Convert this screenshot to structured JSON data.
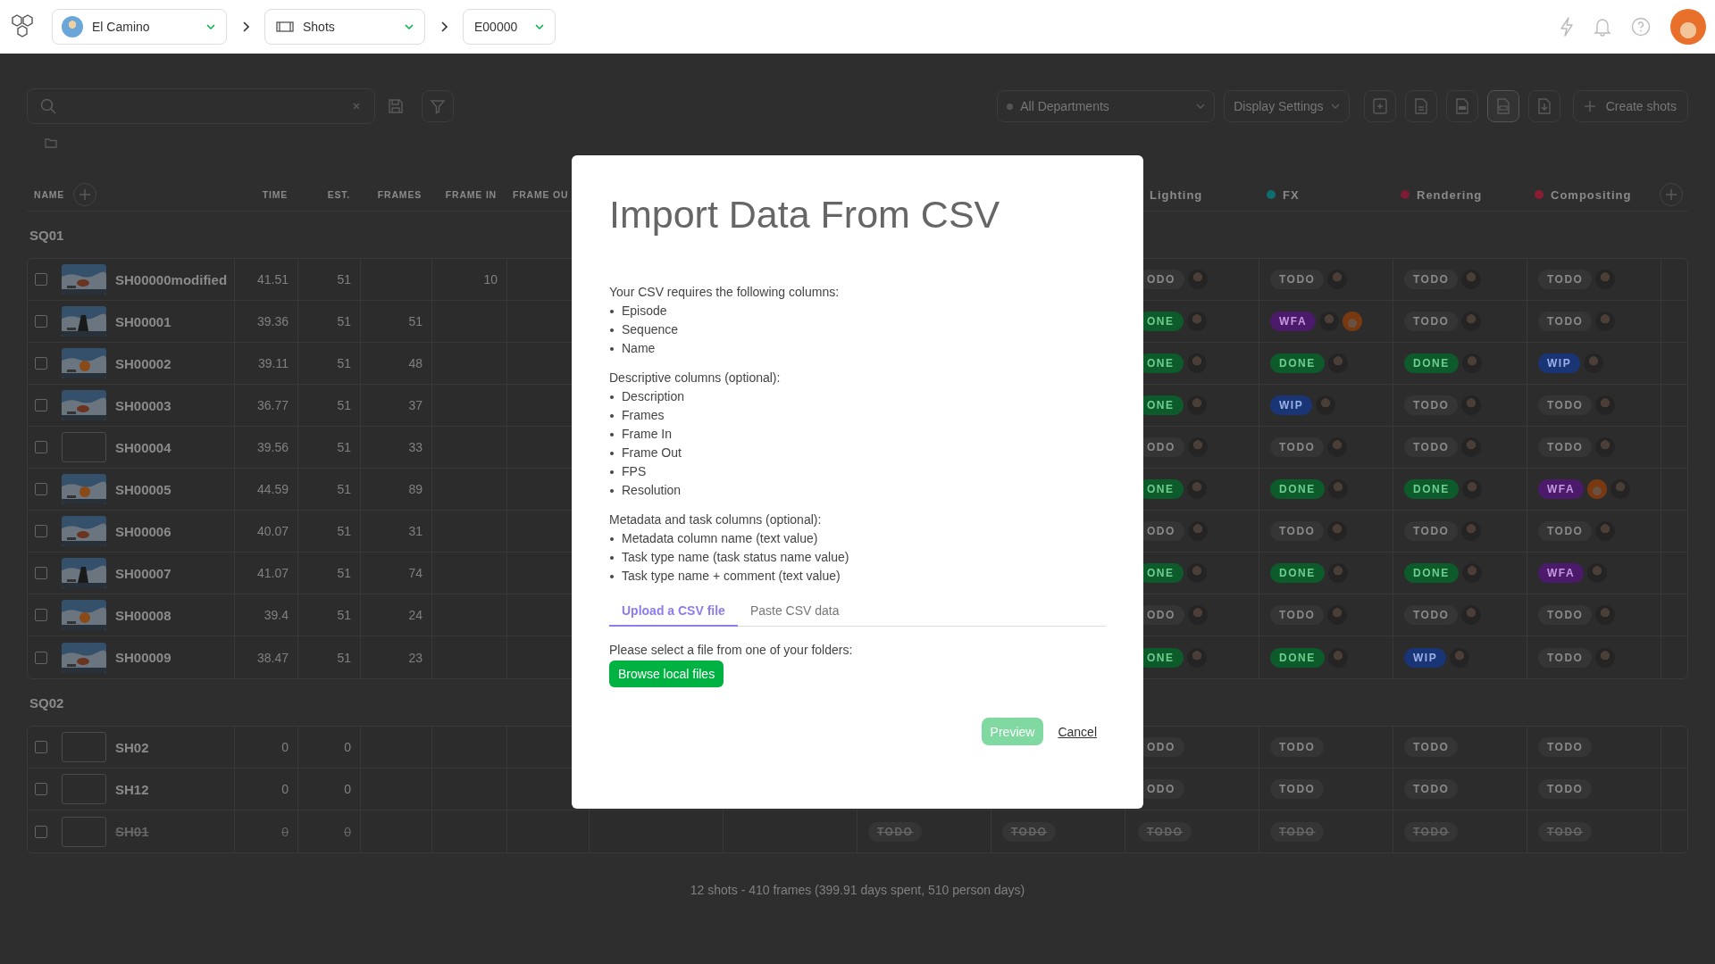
{
  "topbar": {
    "project": "El Camino",
    "section": "Shots",
    "episode": "E00000"
  },
  "toolbar": {
    "department_filter": "All Departments",
    "display_settings": "Display Settings",
    "create_button": "Create shots"
  },
  "table": {
    "columns": [
      {
        "label": "NAME"
      },
      {
        "label": "TIME"
      },
      {
        "label": "EST."
      },
      {
        "label": "FRAMES"
      },
      {
        "label": "FRAME IN"
      },
      {
        "label": "FRAME OU"
      }
    ],
    "task_columns": [
      {
        "name": "Lighting"
      },
      {
        "name": "FX",
        "color": "#0e6e6e"
      },
      {
        "name": "Rendering",
        "color": "#7c1d35"
      },
      {
        "name": "Compositing",
        "color": "#8a1c34"
      }
    ],
    "groups": [
      {
        "name": "SQ01",
        "rows": [
          {
            "name": "SH00000modified",
            "checked": false,
            "canceled": false,
            "thumbnail": true,
            "time": "41.51",
            "est": "51",
            "frame_in": "10",
            "tasks": [
              {
                "status": "ODO",
                "kind": "todo",
                "assignees": [
                  {
                    "kind": "person"
                  }
                ]
              },
              {
                "status": "TODO",
                "kind": "todo",
                "assignees": [
                  {
                    "kind": "person"
                  }
                ]
              },
              {
                "status": "TODO",
                "kind": "todo",
                "assignees": [
                  {
                    "kind": "person"
                  }
                ]
              },
              {
                "status": "TODO",
                "kind": "todo",
                "assignees": [
                  {
                    "kind": "person"
                  }
                ]
              }
            ]
          },
          {
            "name": "SH00001",
            "checked": false,
            "canceled": false,
            "thumbnail": true,
            "time": "39.36",
            "est": "51",
            "frames": "51",
            "tasks": [
              {
                "status": "ONE",
                "kind": "done",
                "assignees": [
                  {
                    "kind": "person"
                  }
                ]
              },
              {
                "status": "WFA",
                "kind": "wfa",
                "assignees": [
                  {
                    "kind": "person"
                  },
                  {
                    "kind": "fox"
                  }
                ]
              },
              {
                "status": "TODO",
                "kind": "todo",
                "assignees": [
                  {
                    "kind": "person"
                  }
                ]
              },
              {
                "status": "TODO",
                "kind": "todo",
                "assignees": [
                  {
                    "kind": "person"
                  }
                ]
              }
            ]
          },
          {
            "name": "SH00002",
            "checked": false,
            "canceled": false,
            "thumbnail": true,
            "time": "39.11",
            "est": "51",
            "frames": "48",
            "tasks": [
              {
                "status": "ONE",
                "kind": "done",
                "assignees": [
                  {
                    "kind": "person"
                  }
                ]
              },
              {
                "status": "DONE",
                "kind": "done",
                "assignees": [
                  {
                    "kind": "person"
                  }
                ]
              },
              {
                "status": "DONE",
                "kind": "done",
                "assignees": [
                  {
                    "kind": "person"
                  }
                ]
              },
              {
                "status": "WIP",
                "kind": "wip",
                "assignees": [
                  {
                    "kind": "person"
                  }
                ]
              }
            ]
          },
          {
            "name": "SH00003",
            "checked": false,
            "canceled": false,
            "thumbnail": true,
            "time": "36.77",
            "est": "51",
            "frames": "37",
            "tasks": [
              {
                "status": "ONE",
                "kind": "done",
                "assignees": [
                  {
                    "kind": "person"
                  }
                ]
              },
              {
                "status": "WIP",
                "kind": "wip",
                "assignees": [
                  {
                    "kind": "person"
                  }
                ]
              },
              {
                "status": "TODO",
                "kind": "todo",
                "assignees": [
                  {
                    "kind": "person"
                  }
                ]
              },
              {
                "status": "TODO",
                "kind": "todo",
                "assignees": [
                  {
                    "kind": "person"
                  }
                ]
              }
            ]
          },
          {
            "name": "SH00004",
            "checked": false,
            "canceled": false,
            "thumbnail": false,
            "time": "39.56",
            "est": "51",
            "frames": "33",
            "tasks": [
              {
                "status": "ODO",
                "kind": "todo",
                "assignees": [
                  {
                    "kind": "person"
                  }
                ]
              },
              {
                "status": "TODO",
                "kind": "todo",
                "assignees": [
                  {
                    "kind": "person"
                  }
                ]
              },
              {
                "status": "TODO",
                "kind": "todo",
                "assignees": [
                  {
                    "kind": "person"
                  }
                ]
              },
              {
                "status": "TODO",
                "kind": "todo",
                "assignees": [
                  {
                    "kind": "person"
                  }
                ]
              }
            ]
          },
          {
            "name": "SH00005",
            "checked": false,
            "canceled": false,
            "thumbnail": true,
            "time": "44.59",
            "est": "51",
            "frames": "89",
            "tasks": [
              {
                "status": "ONE",
                "kind": "done",
                "assignees": [
                  {
                    "kind": "person"
                  }
                ]
              },
              {
                "status": "DONE",
                "kind": "done",
                "assignees": [
                  {
                    "kind": "person"
                  }
                ]
              },
              {
                "status": "DONE",
                "kind": "done",
                "assignees": [
                  {
                    "kind": "person"
                  }
                ]
              },
              {
                "status": "WFA",
                "kind": "wfa",
                "assignees": [
                  {
                    "kind": "fox"
                  },
                  {
                    "kind": "person"
                  }
                ]
              }
            ]
          },
          {
            "name": "SH00006",
            "checked": false,
            "canceled": false,
            "thumbnail": true,
            "time": "40.07",
            "est": "51",
            "frames": "31",
            "tasks": [
              {
                "status": "ODO",
                "kind": "todo",
                "assignees": [
                  {
                    "kind": "person"
                  }
                ]
              },
              {
                "status": "TODO",
                "kind": "todo",
                "assignees": [
                  {
                    "kind": "person"
                  }
                ]
              },
              {
                "status": "TODO",
                "kind": "todo",
                "assignees": [
                  {
                    "kind": "person"
                  }
                ]
              },
              {
                "status": "TODO",
                "kind": "todo",
                "assignees": [
                  {
                    "kind": "person"
                  }
                ]
              }
            ]
          },
          {
            "name": "SH00007",
            "checked": false,
            "canceled": false,
            "thumbnail": true,
            "time": "41.07",
            "est": "51",
            "frames": "74",
            "tasks": [
              {
                "status": "ONE",
                "kind": "done",
                "assignees": [
                  {
                    "kind": "person"
                  }
                ]
              },
              {
                "status": "DONE",
                "kind": "done",
                "assignees": [
                  {
                    "kind": "person"
                  }
                ]
              },
              {
                "status": "DONE",
                "kind": "done",
                "assignees": [
                  {
                    "kind": "person"
                  }
                ]
              },
              {
                "status": "WFA",
                "kind": "wfa",
                "assignees": [
                  {
                    "kind": "person"
                  }
                ]
              }
            ]
          },
          {
            "name": "SH00008",
            "checked": false,
            "canceled": false,
            "thumbnail": true,
            "time": "39.4",
            "est": "51",
            "frames": "24",
            "tasks": [
              {
                "status": "ODO",
                "kind": "todo",
                "assignees": [
                  {
                    "kind": "person"
                  }
                ]
              },
              {
                "status": "TODO",
                "kind": "todo",
                "assignees": [
                  {
                    "kind": "person"
                  }
                ]
              },
              {
                "status": "TODO",
                "kind": "todo",
                "assignees": [
                  {
                    "kind": "person"
                  }
                ]
              },
              {
                "status": "TODO",
                "kind": "todo",
                "assignees": [
                  {
                    "kind": "person"
                  }
                ]
              }
            ]
          },
          {
            "name": "SH00009",
            "checked": false,
            "canceled": false,
            "thumbnail": true,
            "time": "38.47",
            "est": "51",
            "frames": "23",
            "tasks": [
              {
                "status": "ONE",
                "kind": "done",
                "assignees": [
                  {
                    "kind": "person"
                  }
                ]
              },
              {
                "status": "DONE",
                "kind": "done",
                "assignees": [
                  {
                    "kind": "person"
                  }
                ]
              },
              {
                "status": "WIP",
                "kind": "wip",
                "assignees": [
                  {
                    "kind": "person"
                  }
                ]
              },
              {
                "status": "TODO",
                "kind": "todo",
                "assignees": [
                  {
                    "kind": "person"
                  }
                ]
              }
            ]
          }
        ]
      },
      {
        "name": "SQ02",
        "rows": [
          {
            "name": "SH02",
            "checked": false,
            "canceled": false,
            "thumbnail": false,
            "time": "0",
            "est": "0",
            "tasks": [
              {
                "status": "ODO",
                "kind": "todo"
              },
              {
                "status": "TODO",
                "kind": "todo"
              },
              {
                "status": "TODO",
                "kind": "todo"
              },
              {
                "status": "TODO",
                "kind": "todo"
              }
            ]
          },
          {
            "name": "SH12",
            "checked": false,
            "canceled": false,
            "thumbnail": false,
            "time": "0",
            "est": "0",
            "tasks": [
              {
                "status": "ODO",
                "kind": "todo"
              },
              {
                "status": "TODO",
                "kind": "todo"
              },
              {
                "status": "TODO",
                "kind": "todo"
              },
              {
                "status": "TODO",
                "kind": "todo"
              }
            ]
          },
          {
            "name": "SH01",
            "checked": false,
            "canceled": true,
            "thumbnail": false,
            "time": "0",
            "est": "0",
            "covered_tasks": [
              {
                "status": "TODO",
                "kind": "todo"
              },
              {
                "status": "TODO",
                "kind": "todo"
              }
            ],
            "tasks": [
              {
                "status": "TODO",
                "kind": "todo"
              },
              {
                "status": "TODO",
                "kind": "todo"
              },
              {
                "status": "TODO",
                "kind": "todo"
              },
              {
                "status": "TODO",
                "kind": "todo"
              }
            ]
          }
        ]
      }
    ]
  },
  "footer": "12 shots - 410 frames (399.91 days spent, 510 person days)",
  "modal": {
    "title": "Import Data From CSV",
    "sections": [
      {
        "heading": "Your CSV requires the following columns:",
        "items": [
          "Episode",
          "Sequence",
          "Name"
        ]
      },
      {
        "heading": "Descriptive columns (optional):",
        "items": [
          "Description",
          "Frames",
          "Frame In",
          "Frame Out",
          "FPS",
          "Resolution"
        ]
      },
      {
        "heading": "Metadata and task columns (optional):",
        "items": [
          "Metadata column name (text value)",
          "Task type name (task status name value)",
          "Task type name + comment (text value)"
        ]
      }
    ],
    "tabs": [
      {
        "label": "Upload a CSV file",
        "selected": true
      },
      {
        "label": "Paste CSV data",
        "selected": false
      }
    ],
    "file_prompt": "Please select a file from one of your folders:",
    "browse_button": "Browse local files",
    "preview_button": {
      "label": "Preview",
      "disabled": true
    },
    "cancel_link": "Cancel"
  }
}
